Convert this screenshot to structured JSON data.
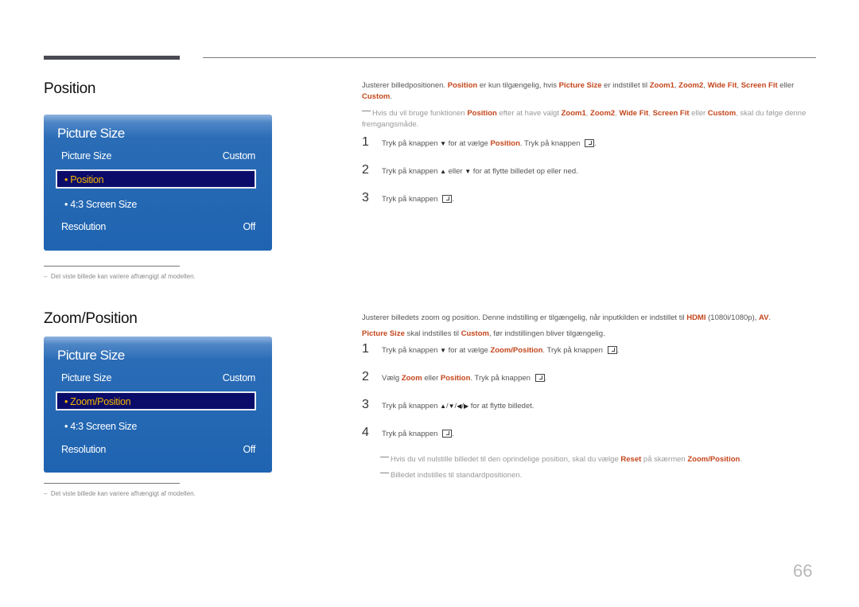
{
  "section1": {
    "title": "Position",
    "osd": {
      "title": "Picture Size",
      "row1_label": "Picture Size",
      "row1_value": "Custom",
      "selected": "• Position",
      "sub": "• 4:3 Screen Size",
      "row_res_label": "Resolution",
      "row_res_value": "Off"
    },
    "footnote": "Det viste billede kan variere afhængigt af modellen.",
    "intro": {
      "t1": "Justerer billedpositionen. ",
      "h1": "Position",
      "t2": " er kun tilgængelig, hvis ",
      "h2": "Picture Size",
      "t3": " er indstillet til ",
      "h3": "Zoom1",
      "t4": ", ",
      "h4": "Zoom2",
      "t5": ", ",
      "h5": "Wide Fit",
      "t6": ", ",
      "h6": "Screen Fit",
      "t7": " eller ",
      "h7": "Custom",
      "t8": "."
    },
    "note": {
      "t1": "Hvis du vil bruge funktionen ",
      "h1": "Position",
      "t2": " efter at have valgt ",
      "h2": "Zoom1",
      "t3": ", ",
      "h3": "Zoom2",
      "t4": ", ",
      "h4": "Wide Fit",
      "t5": ", ",
      "h5": "Screen Fit",
      "t6": " eller ",
      "h6": "Custom",
      "t7": ", skal du følge denne fremgangsmåde."
    },
    "steps": [
      {
        "num": "1",
        "a": "Tryk på knappen ",
        "b": " for at vælge ",
        "hl": "Position",
        "c": ". Tryk på knappen ",
        "d": "."
      },
      {
        "num": "2",
        "a": "Tryk på knappen ",
        "b": " eller ",
        "c": " for at flytte billedet op eller ned."
      },
      {
        "num": "3",
        "a": "Tryk på knappen ",
        "d": "."
      }
    ]
  },
  "section2": {
    "title": "Zoom/Position",
    "osd": {
      "title": "Picture Size",
      "row1_label": "Picture Size",
      "row1_value": "Custom",
      "selected": "• Zoom/Position",
      "sub": "• 4:3 Screen Size",
      "row_res_label": "Resolution",
      "row_res_value": "Off"
    },
    "footnote": "Det viste billede kan variere afhængigt af modellen.",
    "intro": {
      "t1": "Justerer billedets zoom og position. Denne indstilling er tilgængelig, når inputkilden er indstillet til ",
      "h1": "HDMI",
      "t2": " (1080i/1080p), ",
      "h2": "AV",
      "t3": ".",
      "h3": "Picture Size",
      "t4": " skal indstilles til ",
      "h4": "Custom",
      "t5": ", før indstillingen bliver tilgængelig."
    },
    "steps": [
      {
        "num": "1",
        "a": "Tryk på knappen ",
        "b": " for at vælge ",
        "hl": "Zoom/Position",
        "c": ". Tryk på knappen ",
        "d": "."
      },
      {
        "num": "2",
        "a": "Vælg ",
        "hl1": "Zoom",
        "b": " eller ",
        "hl2": "Position",
        "c": ". Tryk på knappen ",
        "d": "."
      },
      {
        "num": "3",
        "a": "Tryk på knappen ",
        "b": " for at flytte billedet."
      },
      {
        "num": "4",
        "a": "Tryk på knappen ",
        "d": "."
      }
    ],
    "notes": [
      {
        "t1": "Hvis du vil nulstille billedet til den oprindelige position, skal du vælge ",
        "h1": "Reset",
        "t2": " på skærmen ",
        "h2": "Zoom/Position",
        "t3": "."
      },
      {
        "t1": "Billedet indstilles til standardpositionen."
      }
    ]
  },
  "icons": {
    "down": "▼",
    "up": "▲",
    "left": "◀",
    "right": "▶",
    "footnote_dash": "–"
  },
  "page_number": "66",
  "colors": {
    "highlight": "#c4461c",
    "osd_blue": "#1f64b1",
    "osd_selected": "#0b0c6a",
    "osd_selected_text": "#f4b400"
  }
}
